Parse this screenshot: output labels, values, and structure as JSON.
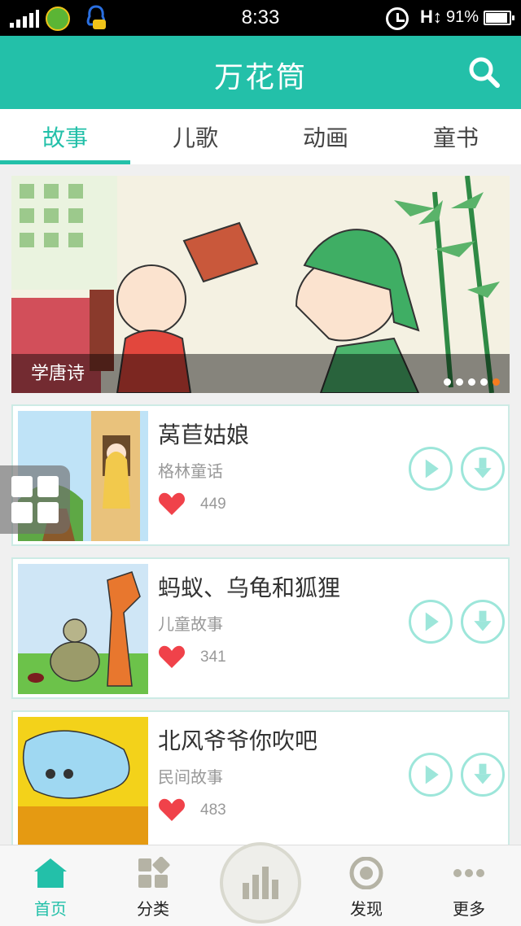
{
  "status_bar": {
    "time": "8:33",
    "battery": "91%"
  },
  "header": {
    "title": "万花筒"
  },
  "tabs": [
    {
      "label": "故事",
      "active": true
    },
    {
      "label": "儿歌",
      "active": false
    },
    {
      "label": "动画",
      "active": false
    },
    {
      "label": "童书",
      "active": false
    }
  ],
  "banner": {
    "caption": "学唐诗",
    "page_count": 5,
    "active_page": 5
  },
  "stories": [
    {
      "title": "莴苣姑娘",
      "category": "格林童话",
      "likes": "449"
    },
    {
      "title": "蚂蚁、乌龟和狐狸",
      "category": "儿童故事",
      "likes": "341"
    },
    {
      "title": "北风爷爷你吹吧",
      "category": "民间故事",
      "likes": "483"
    }
  ],
  "bottom_nav": [
    {
      "label": "首页",
      "active": true
    },
    {
      "label": "分类",
      "active": false
    },
    {
      "label": "发现",
      "active": false
    },
    {
      "label": "更多",
      "active": false
    }
  ],
  "colors": {
    "accent": "#23c0a9",
    "heart": "#f0424a",
    "indicator_active": "#f57c1f"
  }
}
